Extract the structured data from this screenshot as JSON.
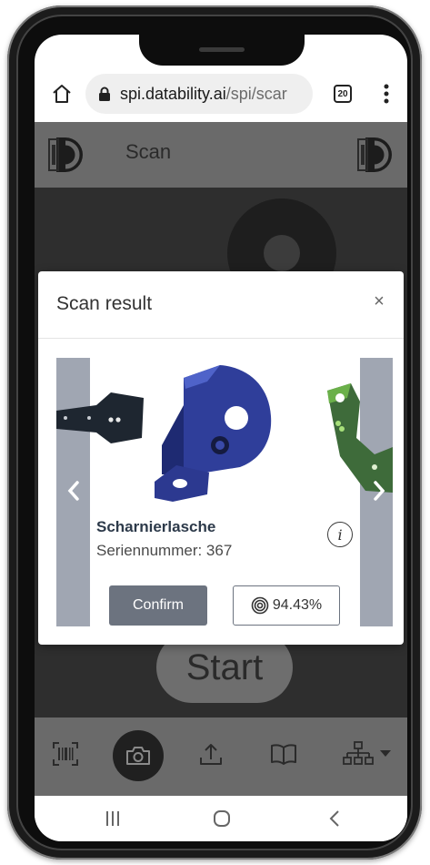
{
  "browser": {
    "url_host": "spi.datability.ai",
    "url_path": "/spi/scar",
    "tab_count": "20"
  },
  "app": {
    "title": "Scan",
    "start_label": "Start",
    "nav_icons": [
      "barcode-icon",
      "camera-icon",
      "upload-icon",
      "book-icon",
      "network-icon",
      "caret-down-icon"
    ]
  },
  "modal": {
    "title": "Scan result",
    "close_label": "×",
    "item_name": "Scharnierlasche",
    "serial_label": "Seriennummer: 367",
    "info_label": "i",
    "confirm_label": "Confirm",
    "score": "94.43%"
  },
  "colors": {
    "accent": "#6c737f",
    "carousel_side": "#a0a6b2",
    "part_blue": "#3a4aa8",
    "part_green": "#3e6b3a"
  }
}
